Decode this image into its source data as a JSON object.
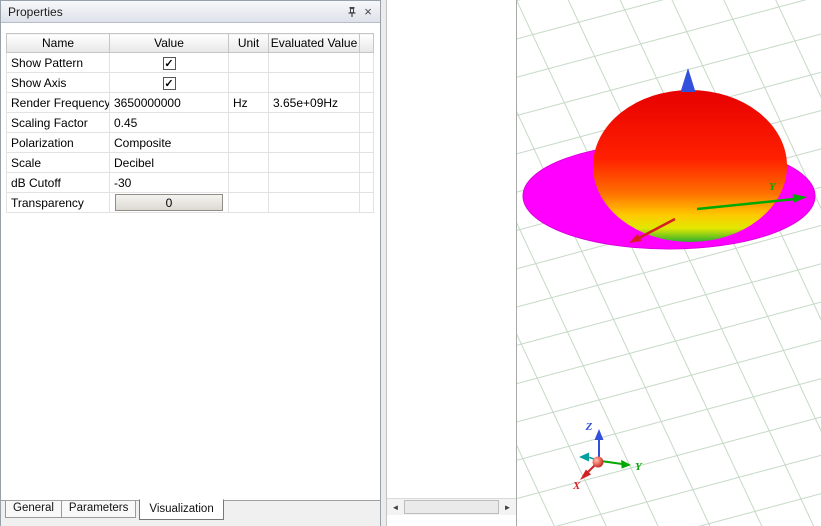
{
  "properties_panel": {
    "title": "Properties",
    "icons": {
      "close": "×"
    },
    "table": {
      "columns": [
        "Name",
        "Value",
        "Unit",
        "Evaluated Value"
      ],
      "rows": [
        {
          "name": "Show Pattern",
          "check": "✓",
          "unit": "",
          "evaluated": ""
        },
        {
          "name": "Show Axis",
          "check": "✓",
          "unit": "",
          "evaluated": ""
        },
        {
          "name": "Render Frequency",
          "value": "3650000000",
          "unit": "Hz",
          "evaluated": "3.65e+09Hz"
        },
        {
          "name": "Scaling Factor",
          "value": "0.45",
          "unit": "",
          "evaluated": ""
        },
        {
          "name": "Polarization",
          "value": "Composite",
          "unit": "",
          "evaluated": ""
        },
        {
          "name": "Scale",
          "value": "Decibel",
          "unit": "",
          "evaluated": ""
        },
        {
          "name": "dB Cutoff",
          "value": "-30",
          "unit": "",
          "evaluated": ""
        },
        {
          "name": "Transparency",
          "button_value": "0",
          "unit": "",
          "evaluated": ""
        }
      ]
    },
    "tabs": [
      {
        "label": "General"
      },
      {
        "label": "Parameters"
      },
      {
        "label": "Visualization"
      }
    ],
    "active_tab": "Visualization"
  },
  "scrollbar": {
    "left_glyph": "◄",
    "right_glyph": "►"
  },
  "viewport": {
    "grid_color": "#c6d9c6",
    "pattern": {
      "ground_plane_color": "#ff00ff",
      "gradient": [
        "#e60000",
        "#ff2000",
        "#ff7000",
        "#ffc800",
        "#e0e800",
        "#2fb02f"
      ]
    },
    "axes": {
      "x_label": "X",
      "y_label": "Y",
      "z_label": "Z",
      "x_color": "#d42020",
      "y_color": "#00a800",
      "z_color": "#3350dd",
      "teal_marker_color": "#00a0a0"
    }
  }
}
